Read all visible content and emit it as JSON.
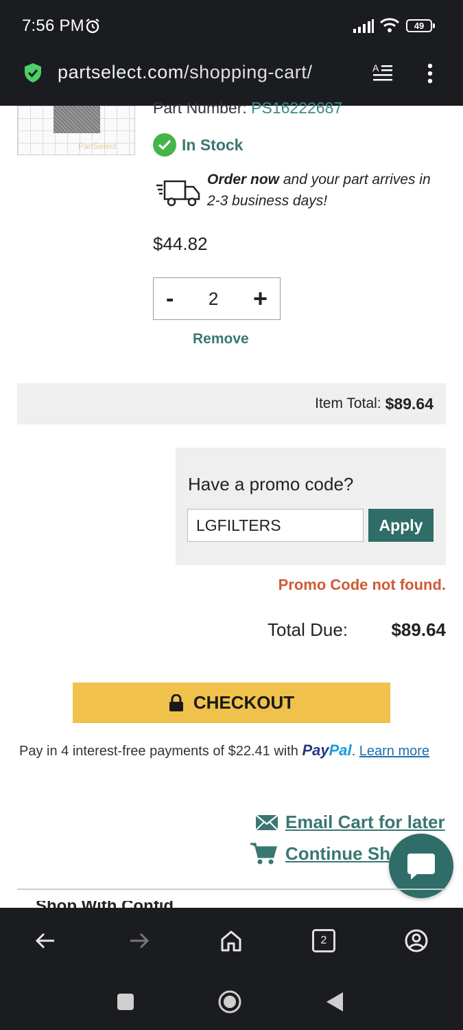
{
  "status_bar": {
    "time": "7:56 PM",
    "battery": "49"
  },
  "browser": {
    "url_domain": "partselect.com",
    "url_path": "/shopping-cart/",
    "tab_count": "2"
  },
  "product": {
    "thumb_watermark": "PartSelect",
    "part_number_label": "Part Number:",
    "part_number": "PS16222687",
    "stock": "In Stock",
    "ship_bold": "Order now",
    "ship_text": " and your part arrives in 2-3 business days!",
    "price": "$44.82",
    "quantity": "2",
    "qty_minus": "-",
    "qty_plus": "+",
    "remove_label": "Remove"
  },
  "item_total": {
    "label": "Item Total:",
    "amount": "$89.64"
  },
  "promo": {
    "title": "Have a promo code?",
    "value": "LGFILTERS",
    "apply_label": "Apply",
    "error": "Promo Code not found."
  },
  "total": {
    "label": "Total Due:",
    "amount": "$89.64"
  },
  "checkout": {
    "label": "CHECKOUT"
  },
  "paypal": {
    "text": "Pay in 4 interest-free payments of $22.41 with ",
    "brand_a": "Pay",
    "brand_b": "Pal",
    "dot": ".",
    "learn_more": "Learn more"
  },
  "links": {
    "email_cart": "Email Cart for later",
    "continue_shopping": "Continue Sho"
  },
  "peek_heading": "Shop With Confid",
  "colors": {
    "accent": "#2f6d68",
    "checkout": "#f0c14b",
    "error": "#d05a32",
    "in_stock": "#46b44a"
  }
}
